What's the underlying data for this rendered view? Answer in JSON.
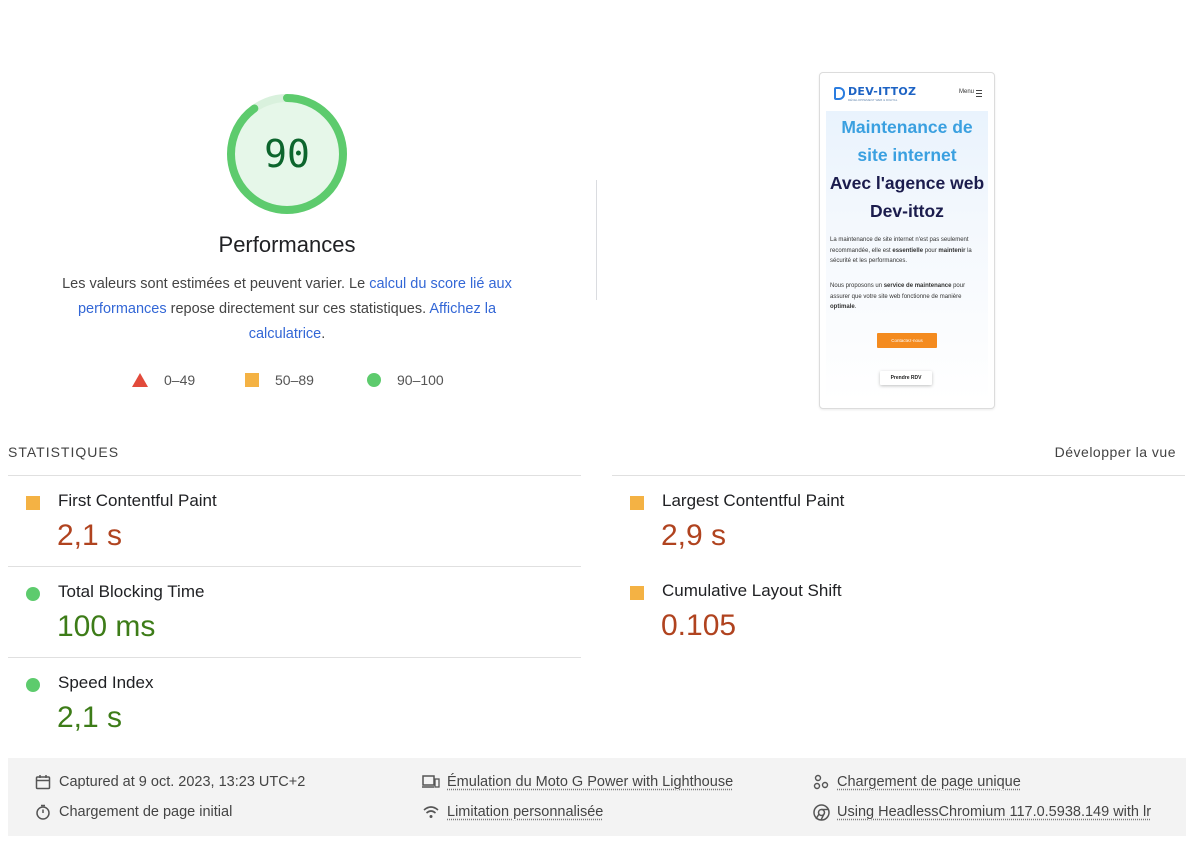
{
  "gauge": {
    "score": "90",
    "score_fraction": 0.9,
    "title": "Performances",
    "description_prefix": "Les valeurs sont estimées et peuvent varier. Le ",
    "score_link": "calcul du score lié aux performances",
    "description_mid": " repose directement sur ces statistiques. ",
    "calculator_link": "Affichez la calculatrice",
    "description_suffix": ".",
    "color": "#5dcb6d"
  },
  "legend": [
    {
      "icon": "triangle-icon",
      "label": "0–49",
      "color": "#e24a3b"
    },
    {
      "icon": "square-icon",
      "label": "50–89",
      "color": "#f4b244"
    },
    {
      "icon": "circle-icon",
      "label": "90–100",
      "color": "#5dcb6d"
    }
  ],
  "preview": {
    "logo_text": "DEV-ITTOZ",
    "logo_sub": "DÉVELOPPEMENT WEB & DIGITAL",
    "menu_label": "Menu",
    "heading_line1": "Maintenance de",
    "heading_line2": "site internet",
    "heading_line3": "Avec l'agence web",
    "heading_line4": "Dev-ittoz",
    "p1_a": "La maintenance de site internet n'est pas seulement recommandée, elle est ",
    "p1_b": "essentielle",
    "p1_c": " pour ",
    "p1_d": "maintenir",
    "p1_e": " la sécurité et les performances.",
    "p2_a": "Nous proposons un ",
    "p2_b": "service de maintenance",
    "p2_c": " pour assurer que votre site web fonctionne de manière ",
    "p2_d": "optimale",
    "p2_e": ".",
    "button1": "Contactez-nous",
    "button2": "Prendre RDV"
  },
  "metrics": {
    "title": "STATISTIQUES",
    "expand_label": "Développer la vue",
    "items": [
      {
        "name": "First Contentful Paint",
        "value": "2,1 s",
        "rating": "average"
      },
      {
        "name": "Largest Contentful Paint",
        "value": "2,9 s",
        "rating": "average"
      },
      {
        "name": "Total Blocking Time",
        "value": "100 ms",
        "rating": "pass"
      },
      {
        "name": "Cumulative Layout Shift",
        "value": "0.105",
        "rating": "average"
      },
      {
        "name": "Speed Index",
        "value": "2,1 s",
        "rating": "pass"
      }
    ],
    "colors": {
      "average": "#f4b244",
      "pass": "#5dcb6d",
      "value_average": "#b0431f",
      "value_pass": "#3d7c18"
    }
  },
  "footer": {
    "captured": "Captured at 9 oct. 2023, 13:23 UTC+2",
    "initial_load": "Chargement de page initial",
    "emulation": "Émulation du Moto G Power with Lighthouse",
    "throttling": "Limitation personnalisée",
    "single_load": "Chargement de page unique",
    "browser": "Using HeadlessChromium 117.0.5938.149 with lr"
  }
}
